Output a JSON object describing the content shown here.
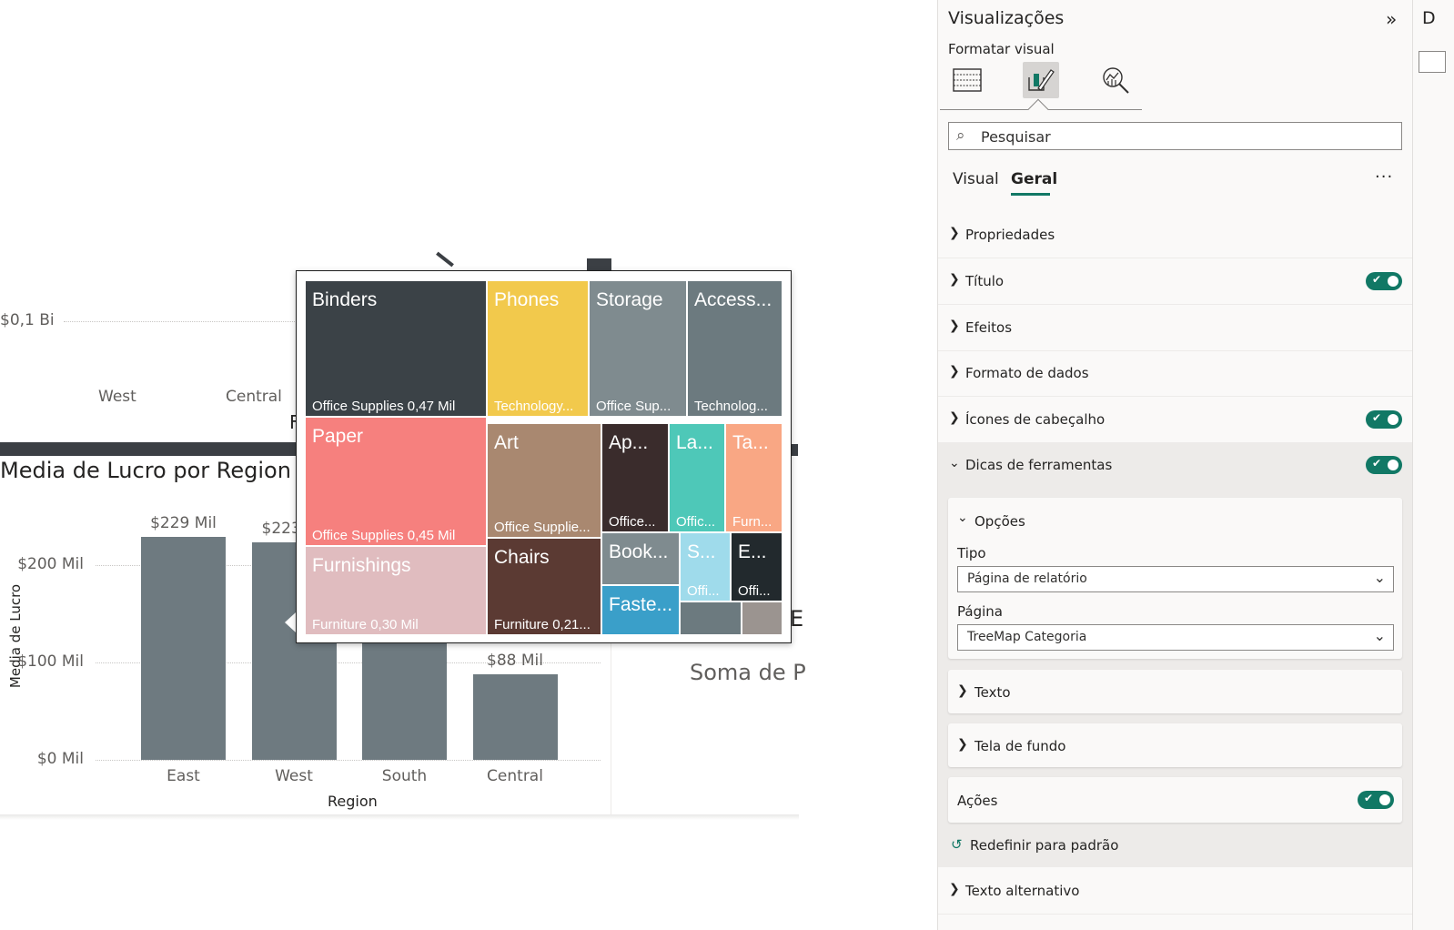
{
  "canvas": {
    "upper_axis_label": "$0,1 Bi",
    "upper_x_labels": [
      "West",
      "Central"
    ],
    "upper_partial_letter": "F",
    "chart_title": "Media de Lucro por Region",
    "x_axis_title": "Region",
    "y_axis_title": "Media de Lucro",
    "right_partial_text": "Soma de P",
    "right_partial_letter": "E"
  },
  "chart_data": {
    "type": "bar",
    "title": "Media de Lucro por Region",
    "xlabel": "Region",
    "ylabel": "Media de Lucro",
    "categories": [
      "East",
      "West",
      "South",
      "Central"
    ],
    "values": [
      229,
      223,
      210,
      88
    ],
    "value_labels": [
      "$229 Mil",
      "$223",
      "",
      "$88 Mil"
    ],
    "yticks": [
      "$0 Mil",
      "$100 Mil",
      "$200 Mil"
    ],
    "ylim": [
      0,
      265
    ],
    "grid": true
  },
  "treemap": {
    "tiles": [
      {
        "name": "Binders",
        "sub": "Office Supplies 0,47 Mil",
        "color": "#3b4247"
      },
      {
        "name": "Phones",
        "sub": "Technology...",
        "color": "#f2c94c"
      },
      {
        "name": "Storage",
        "sub": "Office Sup...",
        "color": "#7f8b8f"
      },
      {
        "name": "Access...",
        "sub": "Technolog...",
        "color": "#6c7a7f"
      },
      {
        "name": "Paper",
        "sub": "Office Supplies 0,45 Mil",
        "color": "#f6807e"
      },
      {
        "name": "Art",
        "sub": "Office Supplie...",
        "color": "#a98870"
      },
      {
        "name": "Ap...",
        "sub": "Office...",
        "color": "#3a2c2c"
      },
      {
        "name": "La...",
        "sub": "Offic...",
        "color": "#4ec8b8"
      },
      {
        "name": "Ta...",
        "sub": "Furn...",
        "color": "#f9a784"
      },
      {
        "name": "Furnishings",
        "sub": "Furniture 0,30 Mil",
        "color": "#e0bcbf"
      },
      {
        "name": "Chairs",
        "sub": "Furniture 0,21...",
        "color": "#5b3a33"
      },
      {
        "name": "Book...",
        "sub": "",
        "color": "#7f8b8f"
      },
      {
        "name": "S...",
        "sub": "Offi...",
        "color": "#9fdbeb"
      },
      {
        "name": "E...",
        "sub": "Offi...",
        "color": "#22292d"
      },
      {
        "name": "Faste...",
        "sub": "",
        "color": "#3a9fc9"
      },
      {
        "name": "",
        "sub": "",
        "color": "#6c7a7f"
      },
      {
        "name": "",
        "sub": "",
        "color": "#9b9490"
      }
    ]
  },
  "pane": {
    "title": "Visualizações",
    "subtitle": "Formatar visual",
    "search_placeholder": "Pesquisar",
    "tabs": [
      "Visual",
      "Geral"
    ],
    "active_tab": "Geral",
    "more_label": "···",
    "sections": {
      "propriedades": "Propriedades",
      "titulo": "Título",
      "efeitos": "Efeitos",
      "formato_dados": "Formato de dados",
      "icones": "Ícones de cabeçalho",
      "dicas": "Dicas de ferramentas",
      "texto_alt": "Texto alternativo"
    },
    "toggle_check": "✔",
    "opcoes": {
      "label": "Opções",
      "tipo_label": "Tipo",
      "tipo_value": "Página de relatório",
      "pagina_label": "Página",
      "pagina_value": "TreeMap Categoria"
    },
    "texto": "Texto",
    "tela_fundo": "Tela de fundo",
    "acoes": "Ações",
    "reset": "Redefinir para padrão",
    "accent_color": "#117865"
  },
  "far_right": {
    "label": "D"
  }
}
